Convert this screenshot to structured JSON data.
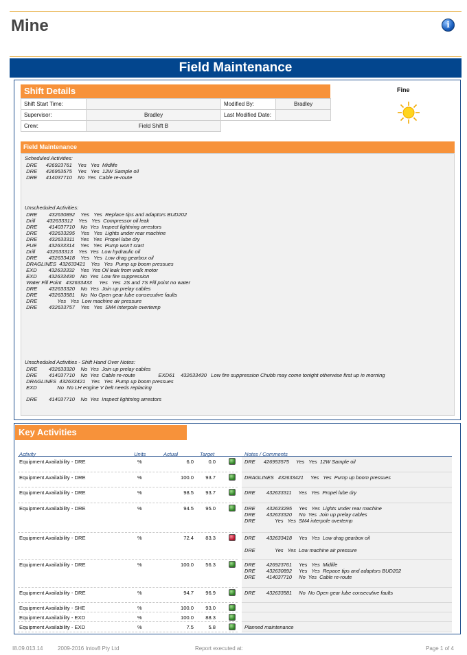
{
  "header": {
    "title": "Mine",
    "info_icon": "info-icon"
  },
  "banner": {
    "title": "Field Maintenance"
  },
  "shift_details": {
    "title": "Shift Details",
    "rows": [
      {
        "label": "Shift Start Time:",
        "value": "",
        "label2": "Modified By:",
        "value2": "Bradley"
      },
      {
        "label": "Supervisor:",
        "value": "Bradley",
        "label2": "Last Modified Date:",
        "value2": ""
      },
      {
        "label": "Crew:",
        "value": "Field Shift B"
      }
    ],
    "weather": {
      "label": "Fine",
      "icon": "sun-icon"
    }
  },
  "field_maintenance": {
    "title": "Field Maintenance",
    "lines": [
      "Scheduled Activities:",
      " DRE      426923761    Yes   Yes  Midlife",
      " DRE      426953575    Yes   Yes  12W Sample oil",
      " DRE      414037710    No  Yes  Cable re-route",
      "Unscheduled Activities:",
      " DRE        432630892    Yes   Yes  Replace tips and adaptors BUD202",
      " Drill        432633312    Yes   Yes  Compressor oil leak",
      " DRE        414037710    No  Yes  Inspect lightning arrestors",
      " DRE        432633295    Yes   Yes  Lights under rear machine",
      " DRE        432633311    Yes   Yes  Propel lube dry",
      " PUE        432633314    Yes   Yes  Pump won't srart",
      " Drill        432633313    Yes  Yes  Low hydraulic oil",
      " DRE        432633418    Yes   Yes  Low drag gearbox oil",
      " DRAGLINES  432633421    Yes   Yes  Pump up boom pressues",
      " EXD        432633332    Yes  Yes Oil leak from walk motor",
      " EXD        432633430    No  Yes  Low fire suppression",
      " Water Fill Point   432633433     Yes   Yes  2S and 7S Fill point no water",
      " DRE        432633320    No  Yes  Join up prelay cables",
      " DRE        432633581    No  No Open gear lube consecutive faults",
      " DRE              Yes   Yes  Low machine air pressure",
      " DRE        432633757    Yes   Yes  SM4 interpole overtemp",
      "Unscheduled Activities - Shift Hand Over Notes:",
      " DRE        432633320    No  Yes  Join up prelay cables",
      " DRE        414037710    No  Yes  Cable re-route                EXD61    432633430   Low fire suppression Chubb may come tonight otherwise first up in morning",
      " DRAGLINES  432633421    Yes   Yes  Pump up boom pressues",
      " EXD              No  No LH engine V belt needs replacing",
      " DRE        414037710    No  Yes  Inspect lightning arrestors"
    ]
  },
  "key_activities": {
    "title": "Key Activities",
    "columns": {
      "activity": "Activity",
      "units": "Units",
      "actual": "Actual",
      "target": "Target",
      "notes": "Notes / Comments"
    },
    "rows": [
      {
        "activity": "Equipment Availability - DRE",
        "units": "%",
        "actual": "6.0",
        "target": "0.0",
        "status": "green",
        "notes": [
          "DRE      426953575     Yes   Yes  12W Sample oil"
        ]
      },
      {
        "activity": "Equipment Availability - DRE",
        "units": "%",
        "actual": "100.0",
        "target": "93.7",
        "status": "green",
        "notes": [
          "DRAGLINES   432633421     Yes   Yes  Pump up boom pressues"
        ]
      },
      {
        "activity": "Equipment Availability - DRE",
        "units": "%",
        "actual": "98.5",
        "target": "93.7",
        "status": "green",
        "notes": [
          "DRE        432633311     Yes   Yes  Propel lube dry"
        ]
      },
      {
        "activity": "Equipment Availability - DRE",
        "units": "%",
        "actual": "94.5",
        "target": "95.0",
        "status": "green",
        "notes": [
          "DRE        432633295     Yes   Yes  Lights under rear machine",
          "DRE        432633320     No  Yes  Join up prelay cables",
          "DRE              Yes   Yes  SM4 interpole overtemp"
        ]
      },
      {
        "activity": "Equipment Availability - DRE",
        "units": "%",
        "actual": "72.4",
        "target": "83.3",
        "status": "red",
        "notes": [
          "DRE        432633418     Yes   Yes  Low drag gearbox oil",
          "",
          "DRE              Yes   Yes  Low machine air pressure"
        ]
      },
      {
        "activity": "Equipment Availability - DRE",
        "units": "%",
        "actual": "100.0",
        "target": "56.3",
        "status": "green",
        "notes": [
          "DRE        426923761     Yes   Yes  Midlife",
          "DRE        432630892     Yes   Yes  Repace tips and adaptors BUD202",
          "DRE        414037710     No  Yes  Cable re-route"
        ]
      },
      {
        "activity": "Equipment Availability - DRE",
        "units": "%",
        "actual": "94.7",
        "target": "96.9",
        "status": "green",
        "notes": [
          "DRE        432633581     No  No Open gear lube consecutive faults"
        ]
      },
      {
        "activity": "Equipment Availability - SHE",
        "units": "%",
        "actual": "100.0",
        "target": "93.0",
        "status": "green",
        "notes": [
          ""
        ]
      },
      {
        "activity": "Equipment Availability - EXD",
        "units": "%",
        "actual": "100.0",
        "target": "88.3",
        "status": "green",
        "notes": [
          ""
        ]
      },
      {
        "activity": "Equipment Availability - EXD",
        "units": "%",
        "actual": "7.5",
        "target": "5.8",
        "status": "green",
        "notes": [
          "Planned maintenance"
        ]
      }
    ]
  },
  "footer": {
    "version": "I8.09.013.14",
    "copyright": "2009-2016 Intov8 Pty Ltd",
    "report": "Report executed at:",
    "page": "Page 1 of 4"
  }
}
